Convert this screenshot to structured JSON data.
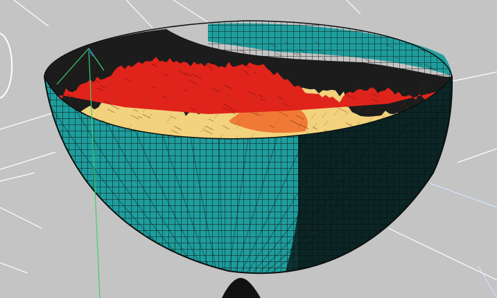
{
  "viewport": {
    "background_color": "#c4c4c4",
    "grid_line_color": "#ffffff",
    "grid_highlight_color": "#cfe4ff"
  },
  "model": {
    "shell_color": "#1f9d9d",
    "shell_shadow_color": "#0b2626",
    "shell_mesh_color": "#0a0f0f",
    "interior_color": "#1c1c1c",
    "terrain_high_color": "#e0241b",
    "terrain_mid_color": "#f07a35",
    "terrain_low_color": "#f2d27c",
    "terrain_mesh_color": "#3b0a06"
  },
  "gizmo": {
    "axis_color": "#3ecf6e",
    "x_axis_color": "#2f3fb0"
  }
}
